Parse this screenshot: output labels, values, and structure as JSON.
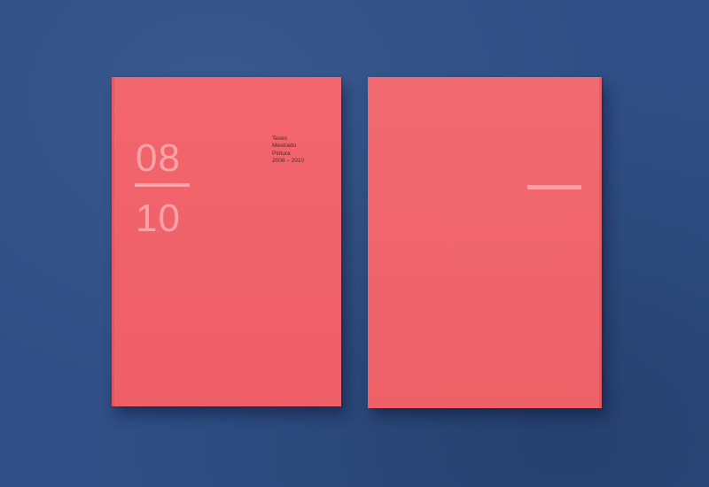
{
  "scene": {
    "background_color": "#2f4f86",
    "book_color": "#f0636b",
    "accent_color": "#f7a3a7"
  },
  "front_cover": {
    "numeral_top": "08",
    "numeral_bottom": "10",
    "title_lines": [
      "Teses",
      "Mestrado",
      "Pintura",
      "2008 – 2010"
    ]
  },
  "back_cover": {}
}
